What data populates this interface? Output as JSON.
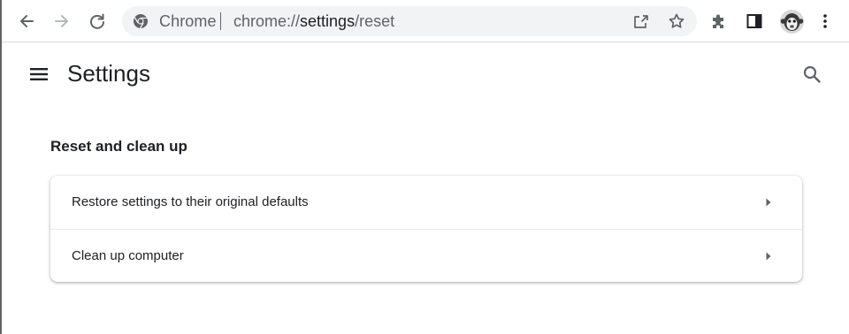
{
  "toolbar": {
    "back_icon": "arrow-back-icon",
    "forward_icon": "arrow-forward-icon",
    "reload_icon": "reload-icon",
    "omnibox": {
      "site_chip": "Chrome",
      "url_scheme": "chrome://",
      "url_host": "settings",
      "url_path": "/reset"
    },
    "share_icon": "share-icon",
    "bookmark_icon": "star-icon",
    "extensions_icon": "puzzle-icon",
    "side_panel_icon": "side-panel-icon",
    "profile_icon": "avatar",
    "menu_icon": "three-dots-icon"
  },
  "header": {
    "title": "Settings"
  },
  "section": {
    "title": "Reset and clean up",
    "rows": [
      {
        "label": "Restore settings to their original defaults"
      },
      {
        "label": "Clean up computer"
      }
    ]
  },
  "colors": {
    "text_primary": "#202124",
    "text_secondary": "#5f6368",
    "omnibox_bg": "#f1f3f4",
    "divider": "#e8eaed"
  }
}
